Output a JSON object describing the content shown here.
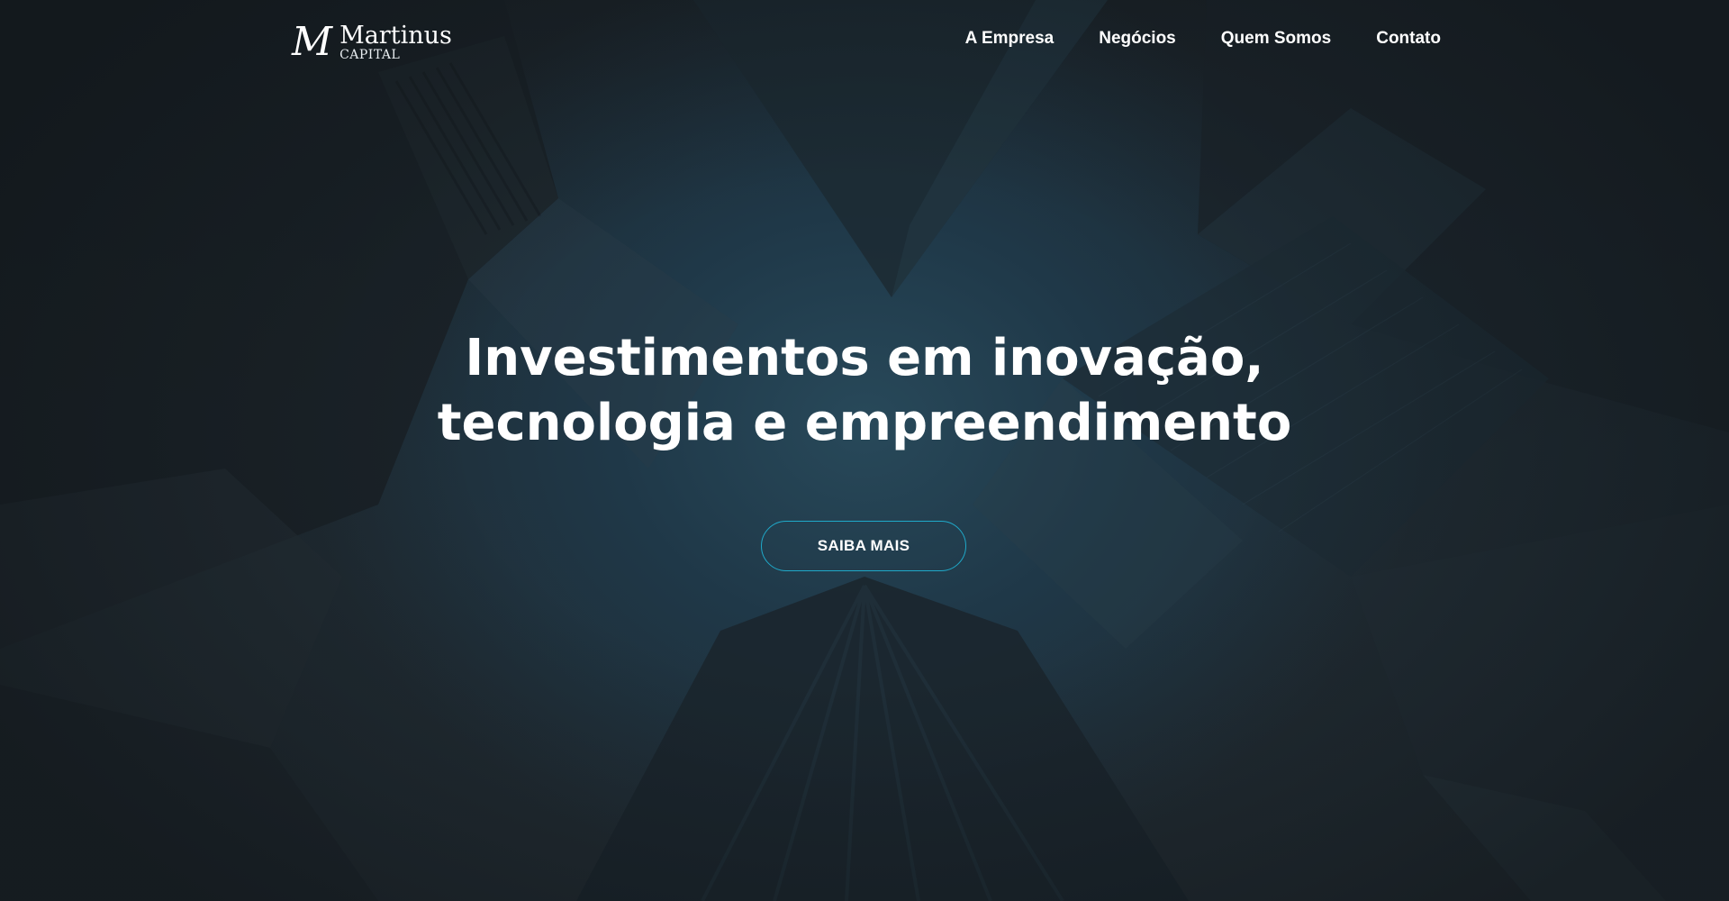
{
  "brand": {
    "mark": "M",
    "name": "Martinus",
    "sub": "CAPITAL"
  },
  "nav": {
    "items": [
      {
        "label": "A Empresa"
      },
      {
        "label": "Negócios"
      },
      {
        "label": "Quem Somos"
      },
      {
        "label": "Contato"
      }
    ]
  },
  "hero": {
    "headline_line1": "Investimentos em inovação,",
    "headline_line2": "tecnologia e empreendimento",
    "cta_label": "SAIBA MAIS"
  },
  "colors": {
    "accent": "#1fa9c9",
    "text": "#ffffff",
    "background": "#1d262c"
  }
}
